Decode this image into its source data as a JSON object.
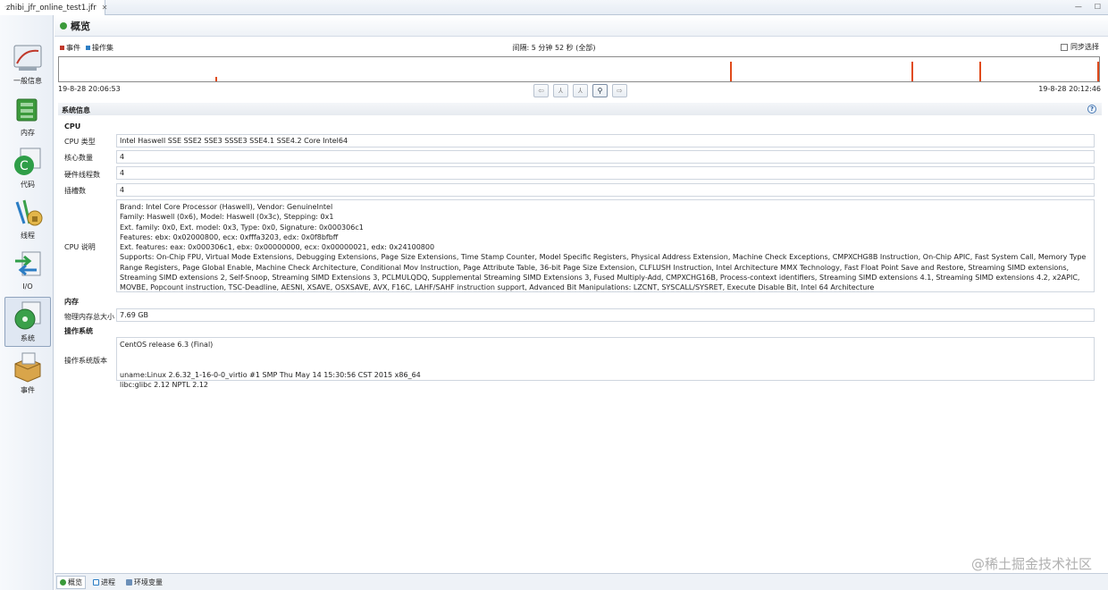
{
  "tab": {
    "label": "zhibi_jfr_online_test1.jfr",
    "close": "✕"
  },
  "window_buttons": [
    "—",
    "☐"
  ],
  "sidebar": [
    {
      "label": "一般信息",
      "icon": "gauge-icon"
    },
    {
      "label": "内存",
      "icon": "memory-chip-icon"
    },
    {
      "label": "代码",
      "icon": "code-icon"
    },
    {
      "label": "线程",
      "icon": "threads-lock-icon"
    },
    {
      "label": "I/O",
      "icon": "io-arrows-icon"
    },
    {
      "label": "系统",
      "icon": "system-disc-icon"
    },
    {
      "label": "事件",
      "icon": "events-box-icon"
    }
  ],
  "header": {
    "title": "概览"
  },
  "timeline": {
    "legend": [
      {
        "label": "事件",
        "color": "#c0392b"
      },
      {
        "label": "操作集",
        "color": "#2e7ec4"
      }
    ],
    "interval": "间隔: 5 分钟 52 秒 (全部)",
    "sync_select": "同步选择",
    "start": "19-8-28 20:06:53",
    "end": "19-8-28 20:12:46",
    "events": [
      {
        "pos": 0.15,
        "level": 0.2
      },
      {
        "pos": 0.645,
        "level": 0.8
      },
      {
        "pos": 0.82,
        "level": 0.8
      },
      {
        "pos": 0.885,
        "level": 0.8
      },
      {
        "pos": 0.999,
        "level": 0.8
      }
    ]
  },
  "section": {
    "title": "系统信息",
    "help": "?",
    "cpu_group": "CPU",
    "cpu_type_label": "CPU 类型",
    "cpu_type": "Intel Haswell SSE SSE2 SSE3 SSSE3 SSE4.1 SSE4.2 Core Intel64",
    "cores_label": "核心数量",
    "cores": "4",
    "hw_threads_label": "硬件线程数",
    "hw_threads": "4",
    "sockets_label": "插槽数",
    "sockets": "4",
    "cpu_desc_label": "CPU 说明",
    "cpu_desc": "Brand: Intel Core Processor (Haswell), Vendor: GenuineIntel\nFamily: Haswell (0x6), Model: Haswell (0x3c), Stepping: 0x1\nExt. family: 0x0, Ext. model: 0x3, Type: 0x0, Signature: 0x000306c1\nFeatures: ebx: 0x02000800, ecx: 0xfffa3203, edx: 0x0f8bfbff\nExt. features: eax: 0x000306c1, ebx: 0x00000000, ecx: 0x00000021, edx: 0x24100800\nSupports: On-Chip FPU, Virtual Mode Extensions, Debugging Extensions, Page Size Extensions, Time Stamp Counter, Model Specific Registers, Physical Address Extension, Machine Check Exceptions, CMPXCHG8B Instruction, On-Chip APIC, Fast System Call, Memory Type Range Registers, Page Global Enable, Machine Check Architecture, Conditional Mov Instruction, Page Attribute Table, 36-bit Page Size Extension, CLFLUSH Instruction, Intel Architecture MMX Technology, Fast Float Point Save and Restore, Streaming SIMD extensions, Streaming SIMD extensions 2, Self-Snoop, Streaming SIMD Extensions 3, PCLMULQDQ, Supplemental Streaming SIMD Extensions 3, Fused Multiply-Add, CMPXCHG16B, Process-context identifiers, Streaming SIMD extensions 4.1, Streaming SIMD extensions 4.2, x2APIC, MOVBE, Popcount instruction, TSC-Deadline, AESNI, XSAVE, OSXSAVE, AVX, F16C, LAHF/SAHF instruction support, Advanced Bit Manipulations: LZCNT, SYSCALL/SYSRET, Execute Disable Bit, Intel 64 Architecture",
    "memory_group": "内存",
    "phys_mem_label": "物理内存总大小",
    "phys_mem": "7.69 GB",
    "os_group": "操作系统",
    "os_version_label": "操作系统版本",
    "os_version": "CentOS release 6.3 (Final)\n\n\nuname:Linux 2.6.32_1-16-0-0_virtio #1 SMP Thu May 14 15:30:56 CST 2015 x86_64\nlibc:glibc 2.12 NPTL 2.12"
  },
  "bottom_tabs": [
    {
      "label": "概览",
      "icon": "overview-icon",
      "active": true
    },
    {
      "label": "进程",
      "icon": "process-icon",
      "active": false
    },
    {
      "label": "环境变量",
      "icon": "env-vars-icon",
      "active": false
    }
  ],
  "watermark": "@稀土掘金技术社区"
}
